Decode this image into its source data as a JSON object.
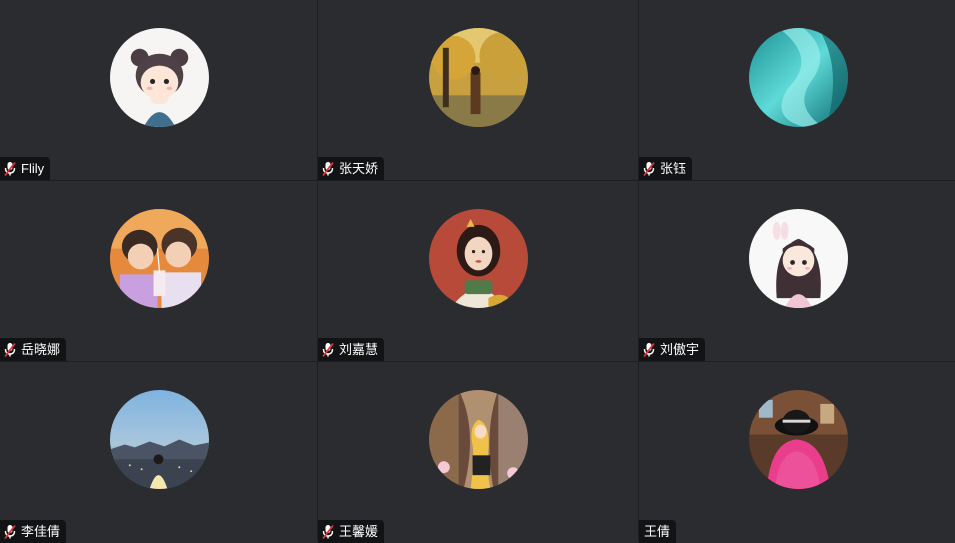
{
  "participants": [
    {
      "name": "Flily",
      "muted": true,
      "mic_icon": "mic-muted-icon",
      "avatar": "cartoon-girl-avatar"
    },
    {
      "name": "张天娇",
      "muted": true,
      "mic_icon": "mic-muted-icon",
      "avatar": "autumn-trees-photo-avatar"
    },
    {
      "name": "张钰",
      "muted": true,
      "mic_icon": "mic-muted-icon",
      "avatar": "teal-abstract-avatar"
    },
    {
      "name": "岳晓娜",
      "muted": true,
      "mic_icon": "mic-muted-icon",
      "avatar": "two-kids-photo-avatar"
    },
    {
      "name": "刘嘉慧",
      "muted": true,
      "mic_icon": "mic-muted-icon",
      "avatar": "illustrated-woman-avatar"
    },
    {
      "name": "刘傲宇",
      "muted": true,
      "mic_icon": "mic-muted-icon",
      "avatar": "cartoon-girl-bunny-avatar"
    },
    {
      "name": "李佳倩",
      "muted": true,
      "mic_icon": "mic-muted-icon",
      "avatar": "city-dusk-photo-avatar"
    },
    {
      "name": "王馨媛",
      "muted": true,
      "mic_icon": "mic-muted-icon",
      "avatar": "princess-illustration-avatar"
    },
    {
      "name": "王倩",
      "muted": false,
      "mic_icon": "",
      "avatar": "person-hat-photo-avatar"
    }
  ],
  "colors": {
    "tile_background": "#2a2c30",
    "nameplate_background": "#121315",
    "mic_muted_red": "#e0323a"
  }
}
